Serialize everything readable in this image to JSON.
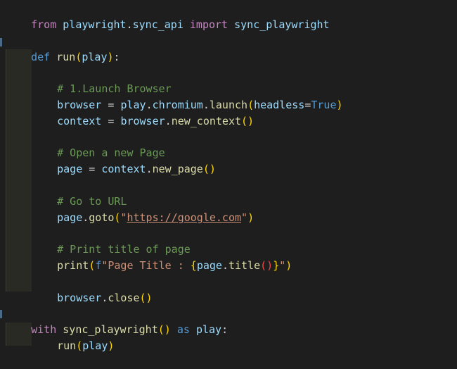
{
  "editor": {
    "theme": {
      "background": "#1e1e1e",
      "keyword": "#c586c0",
      "storage": "#569cd6",
      "function": "#dcdcaa",
      "variable": "#9cdcfe",
      "comment": "#6a9955",
      "string": "#ce9178"
    },
    "lines": {
      "l1": {
        "t1": "from",
        "t2": " ",
        "t3": "playwright",
        "t4": ".",
        "t5": "sync_api",
        "t6": " ",
        "t7": "import",
        "t8": " ",
        "t9": "sync_playwright"
      },
      "l3": {
        "t1": "def",
        "t2": " ",
        "t3": "run",
        "t4": "(",
        "t5": "play",
        "t6": ")",
        "t7": ":"
      },
      "l5": {
        "t1": "# 1.Launch Browser"
      },
      "l6": {
        "t1": "browser",
        "t2": " = ",
        "t3": "play",
        "t4": ".",
        "t5": "chromium",
        "t6": ".",
        "t7": "launch",
        "t8": "(",
        "t9": "headless",
        "t10": "=",
        "t11": "True",
        "t12": ")"
      },
      "l7": {
        "t1": "context",
        "t2": " = ",
        "t3": "browser",
        "t4": ".",
        "t5": "new_context",
        "t6": "()"
      },
      "l9": {
        "t1": "# Open a new Page"
      },
      "l10": {
        "t1": "page",
        "t2": " = ",
        "t3": "context",
        "t4": ".",
        "t5": "new_page",
        "t6": "()"
      },
      "l12": {
        "t1": "# Go to URL"
      },
      "l13": {
        "t1": "page",
        "t2": ".",
        "t3": "goto",
        "t4": "(",
        "t5": "\"",
        "t6": "https://google.com",
        "t7": "\"",
        "t8": ")"
      },
      "l15": {
        "t1": "# Print title of page"
      },
      "l16": {
        "t1": "print",
        "t2": "(",
        "t3": "f",
        "t4": "\"Page Title : ",
        "t5": "{",
        "t6": "page",
        "t7": ".",
        "t8": "title",
        "t9": "()",
        "t10": "}",
        "t11": "\"",
        "t12": ")"
      },
      "l18": {
        "t1": "browser",
        "t2": ".",
        "t3": "close",
        "t4": "()"
      },
      "l20": {
        "t1": "with",
        "t2": " ",
        "t3": "sync_playwright",
        "t4": "()",
        "t5": " ",
        "t6": "as",
        "t7": " ",
        "t8": "play",
        "t9": ":"
      },
      "l21": {
        "t1": "run",
        "t2": "(",
        "t3": "play",
        "t4": ")"
      }
    }
  }
}
